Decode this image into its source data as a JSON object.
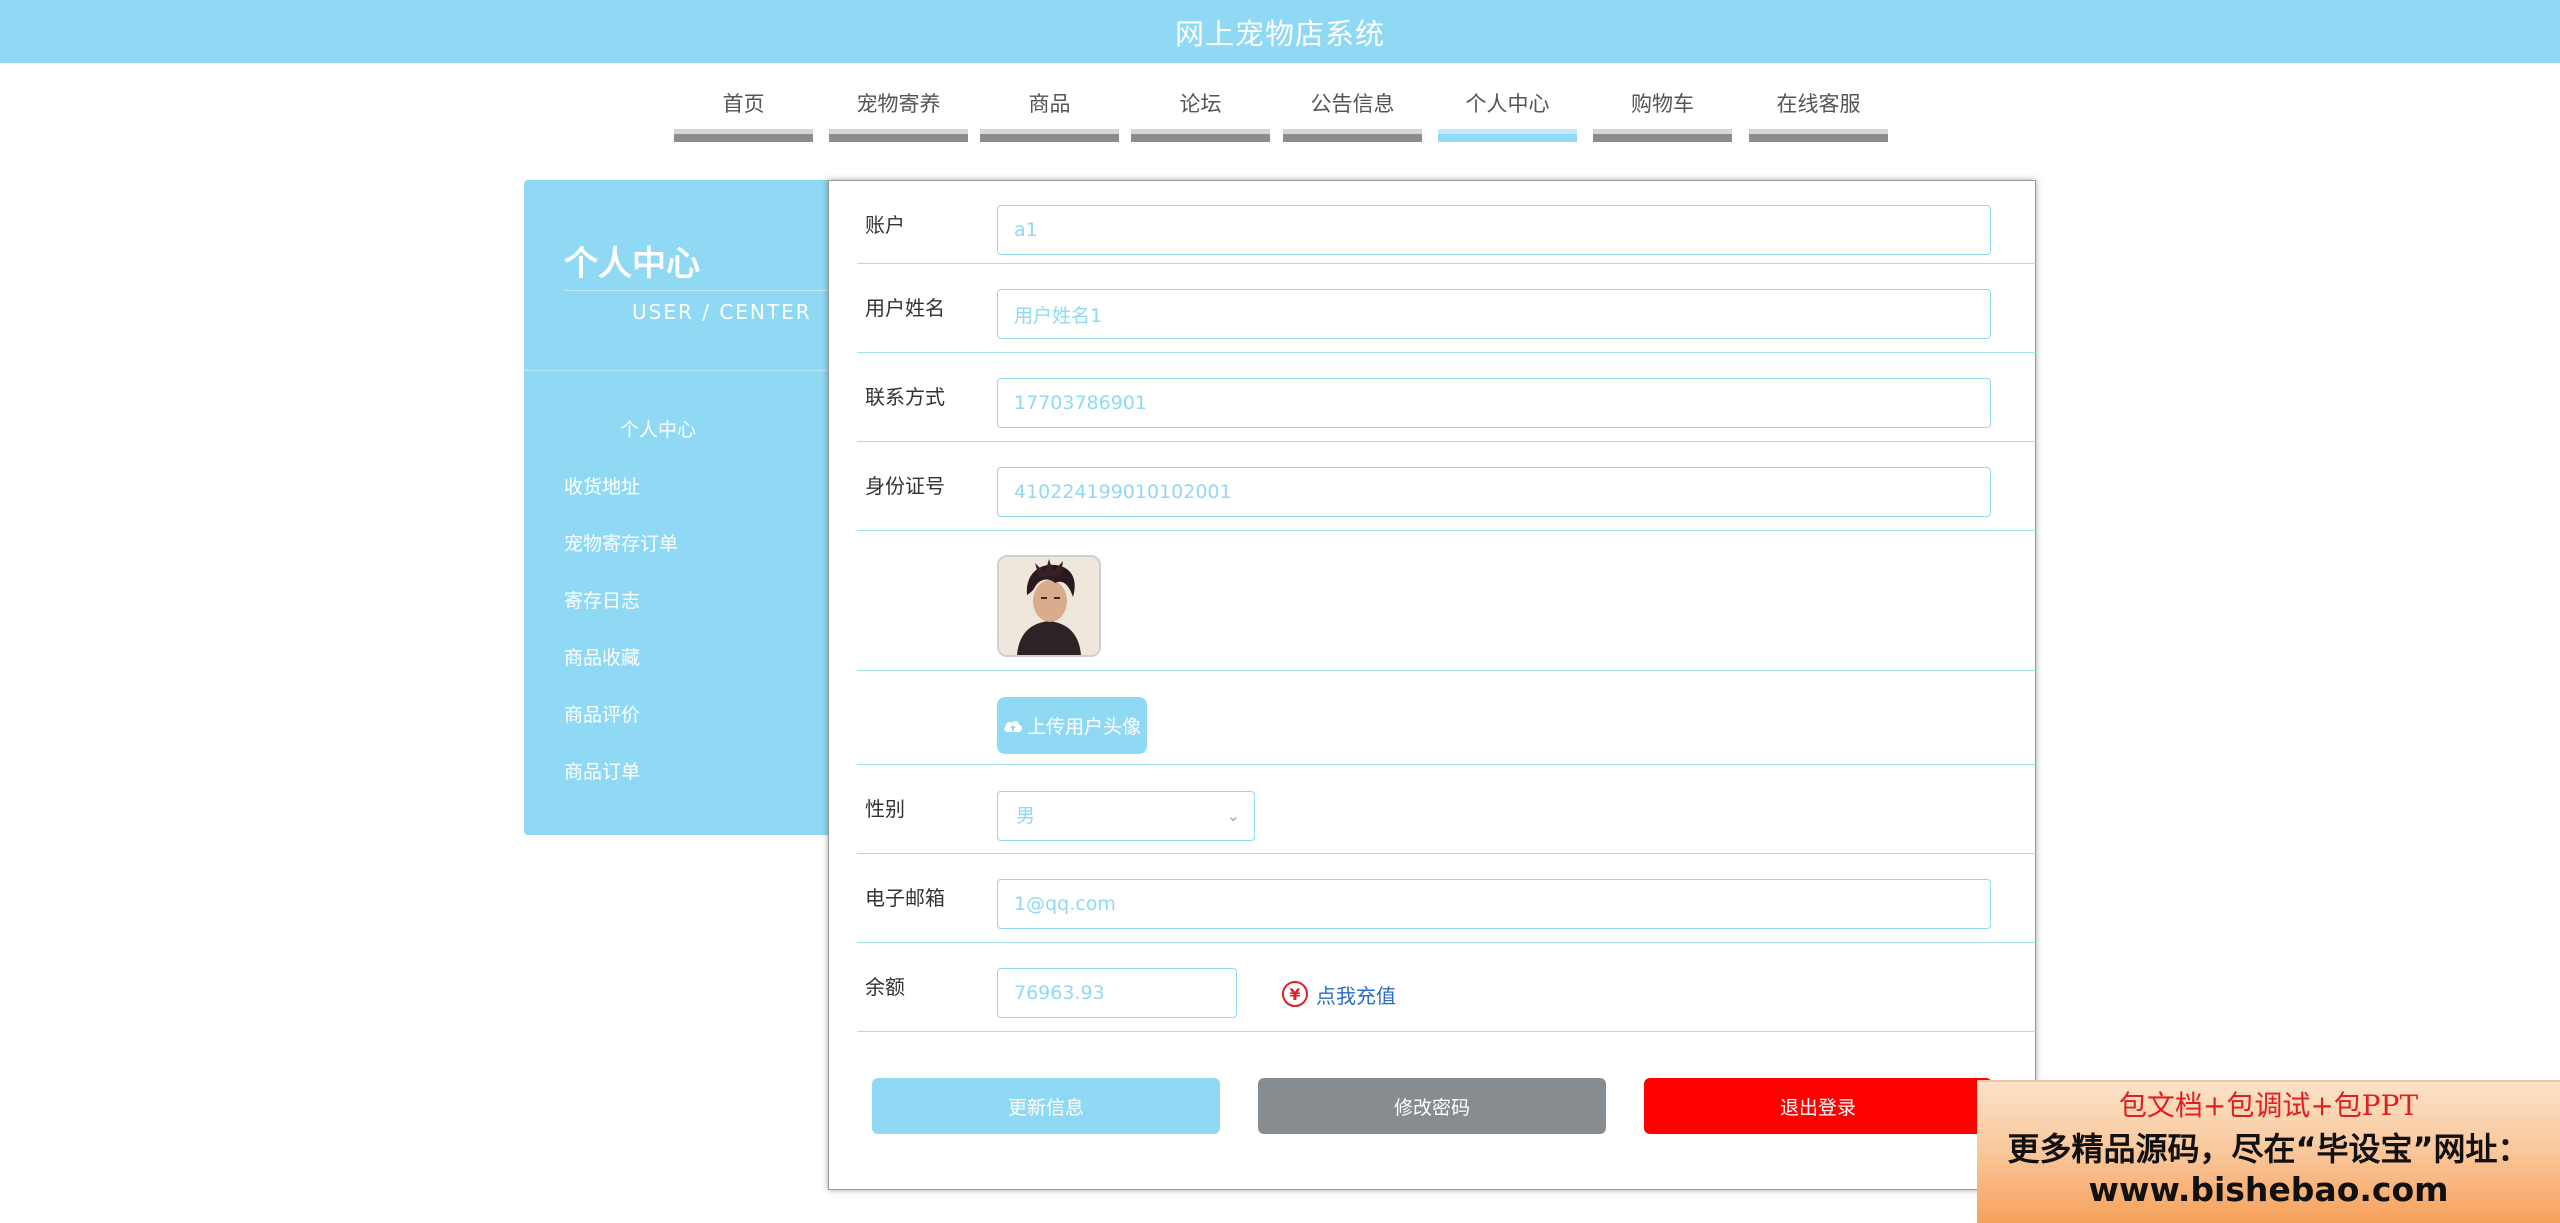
{
  "header": {
    "title": "网上宠物店系统"
  },
  "nav": {
    "items": [
      {
        "label": "首页"
      },
      {
        "label": "宠物寄养"
      },
      {
        "label": "商品"
      },
      {
        "label": "论坛"
      },
      {
        "label": "公告信息"
      },
      {
        "label": "个人中心",
        "active": true
      },
      {
        "label": "购物车"
      },
      {
        "label": "在线客服"
      }
    ]
  },
  "sidebar": {
    "title": "个人中心",
    "subtitle": "USER / CENTER",
    "items": [
      {
        "label": "个人中心",
        "active": true
      },
      {
        "label": "收货地址"
      },
      {
        "label": "宠物寄存订单"
      },
      {
        "label": "寄存日志"
      },
      {
        "label": "商品收藏"
      },
      {
        "label": "商品评价"
      },
      {
        "label": "商品订单"
      }
    ]
  },
  "form": {
    "account": {
      "label": "账户",
      "value": "a1"
    },
    "name": {
      "label": "用户姓名",
      "value": "用户姓名1"
    },
    "phone": {
      "label": "联系方式",
      "value": "17703786901"
    },
    "id_card": {
      "label": "身份证号",
      "value": "410224199010102001"
    },
    "upload_label": "上传用户头像",
    "gender": {
      "label": "性别",
      "value": "男"
    },
    "email": {
      "label": "电子邮箱",
      "value": "1@qq.com"
    },
    "balance": {
      "label": "余额",
      "value": "76963.93"
    },
    "recharge_label": "点我充值"
  },
  "buttons": {
    "update": "更新信息",
    "change_password": "修改密码",
    "logout": "退出登录"
  },
  "promo": {
    "line1": "包文档+包调试+包PPT",
    "line2": "更多精品源码，尽在“毕设宝”网址：",
    "line3": "www.bishebao.com"
  },
  "icons": {
    "upload": "cloud-upload-icon",
    "dropdown": "chevron-down-icon",
    "currency": "yen-icon"
  },
  "colors": {
    "accent": "#8fd9f4",
    "secondary_button": "#868c8f",
    "danger": "#ff0000",
    "link": "#2a6dc6"
  }
}
